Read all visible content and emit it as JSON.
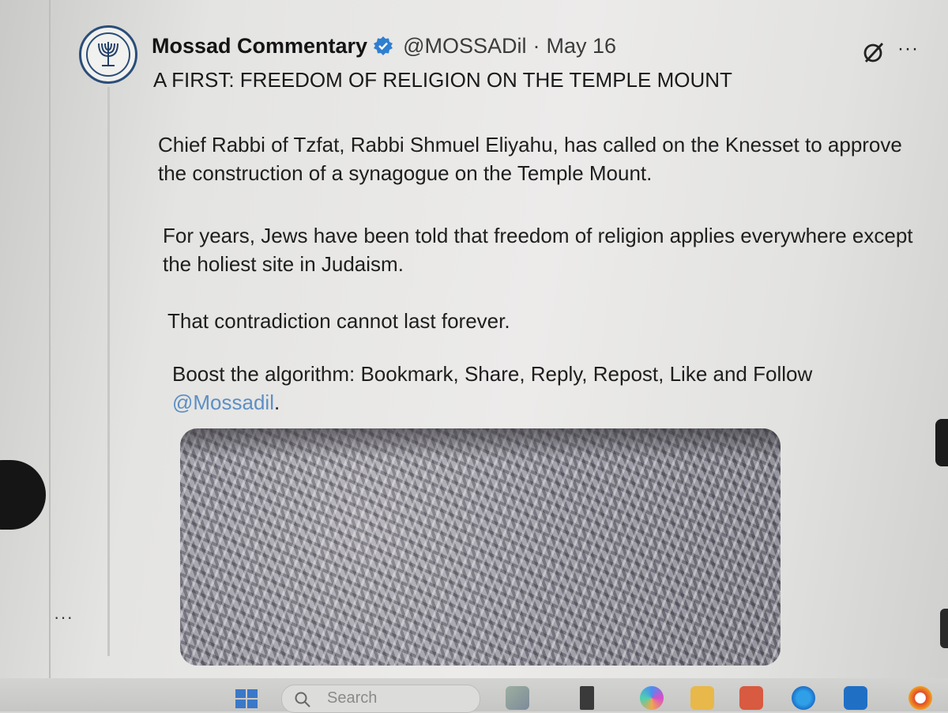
{
  "tweet": {
    "display_name": "Mossad Commentary",
    "handle": "@MOSSADil",
    "separator": "·",
    "date": "May 16",
    "headline": "A FIRST: FREEDOM OF RELIGION ON THE TEMPLE MOUNT",
    "paragraphs": [
      "Chief Rabbi of Tzfat, Rabbi Shmuel Eliyahu, has called on the Knesset to approve the construction of a synagogue on the Temple Mount.",
      "For years, Jews have been told that freedom of religion applies everywhere except the holiest site in Judaism.",
      "That contradiction cannot last forever.",
      "Boost the algorithm: Bookmark, Share, Reply, Repost, Like and Follow "
    ],
    "mention": "@Mossadil",
    "mention_suffix": ".",
    "icons": {
      "avatar": "menorah-emblem-icon",
      "verified": "verified-badge-icon",
      "grok": "grok-icon",
      "more": "more-options-icon"
    },
    "more_glyph": "···",
    "mention_color": "#5d8fc4"
  },
  "left_panel": {
    "more_glyph": "···"
  },
  "taskbar": {
    "search_placeholder": "Search",
    "icons": [
      "windows-start-icon",
      "search-icon",
      "widgets-icon",
      "file-icon",
      "copilot-icon",
      "file-explorer-icon",
      "store-icon",
      "edge-icon",
      "outlook-icon",
      "firefox-icon"
    ]
  }
}
